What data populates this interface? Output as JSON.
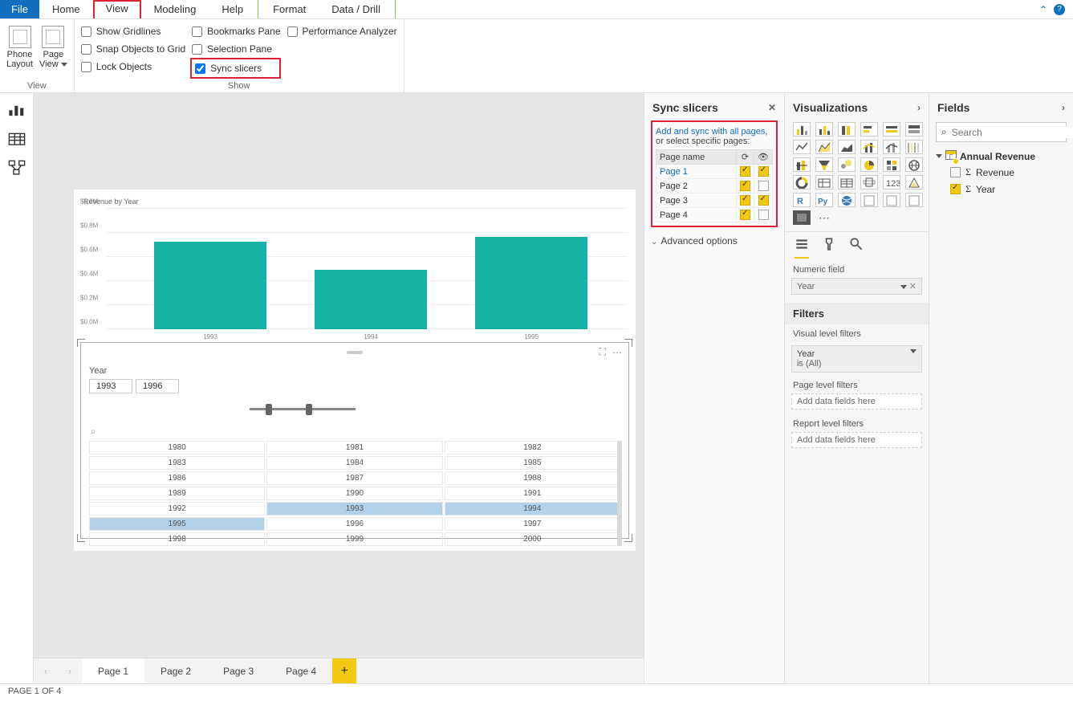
{
  "menu": {
    "file": "File",
    "tabs": [
      "Home",
      "View",
      "Modeling",
      "Help"
    ],
    "context": [
      "Format",
      "Data / Drill"
    ]
  },
  "ribbon": {
    "view": {
      "phone": "Phone\nLayout",
      "page": "Page\nView",
      "group_label": "View"
    },
    "show": {
      "gridlines": "Show Gridlines",
      "snap": "Snap Objects to Grid",
      "lock": "Lock Objects",
      "bookmarks": "Bookmarks Pane",
      "selection": "Selection Pane",
      "sync": "Sync slicers",
      "perf": "Performance Analyzer",
      "group_label": "Show"
    }
  },
  "chart_data": {
    "type": "bar",
    "title": "Revenue by Year",
    "categories": [
      "1993",
      "1994",
      "1995"
    ],
    "values": [
      0.78,
      0.53,
      0.82
    ],
    "ylabel": "",
    "y_ticks": [
      "$0.0M",
      "$0.2M",
      "$0.4M",
      "$0.6M",
      "$0.8M",
      "$1.0M"
    ],
    "ylim": [
      0,
      1.0
    ]
  },
  "slicer": {
    "label": "Year",
    "from": "1993",
    "to": "1996",
    "years": [
      "1980",
      "1981",
      "1982",
      "1983",
      "1984",
      "1985",
      "1986",
      "1987",
      "1988",
      "1989",
      "1990",
      "1991",
      "1992",
      "1993",
      "1994",
      "1995",
      "1996",
      "1997",
      "1998",
      "1999",
      "2000"
    ],
    "selected": [
      "1993",
      "1994",
      "1995"
    ]
  },
  "pages": [
    "Page 1",
    "Page 2",
    "Page 3",
    "Page 4"
  ],
  "status": "PAGE 1 OF 4",
  "sync_panel": {
    "title": "Sync slicers",
    "link": "Add and sync with all pages",
    "sub": "or select specific pages:",
    "header": "Page name",
    "rows": [
      {
        "name": "Page 1",
        "sync": true,
        "visible": true,
        "active": true
      },
      {
        "name": "Page 2",
        "sync": true,
        "visible": false
      },
      {
        "name": "Page 3",
        "sync": true,
        "visible": true
      },
      {
        "name": "Page 4",
        "sync": true,
        "visible": false
      }
    ],
    "advanced": "Advanced options"
  },
  "viz_panel": {
    "title": "Visualizations",
    "numeric_label": "Numeric field",
    "field_value": "Year",
    "filters_title": "Filters",
    "vlf": "Visual level filters",
    "vlf_field": "Year",
    "vlf_sub": "is (All)",
    "plf": "Page level filters",
    "rlf": "Report level filters",
    "add_placeholder": "Add data fields here"
  },
  "fields_panel": {
    "title": "Fields",
    "search_placeholder": "Search",
    "table": "Annual Revenue",
    "fields": [
      {
        "name": "Revenue",
        "checked": false
      },
      {
        "name": "Year",
        "checked": true
      }
    ]
  }
}
